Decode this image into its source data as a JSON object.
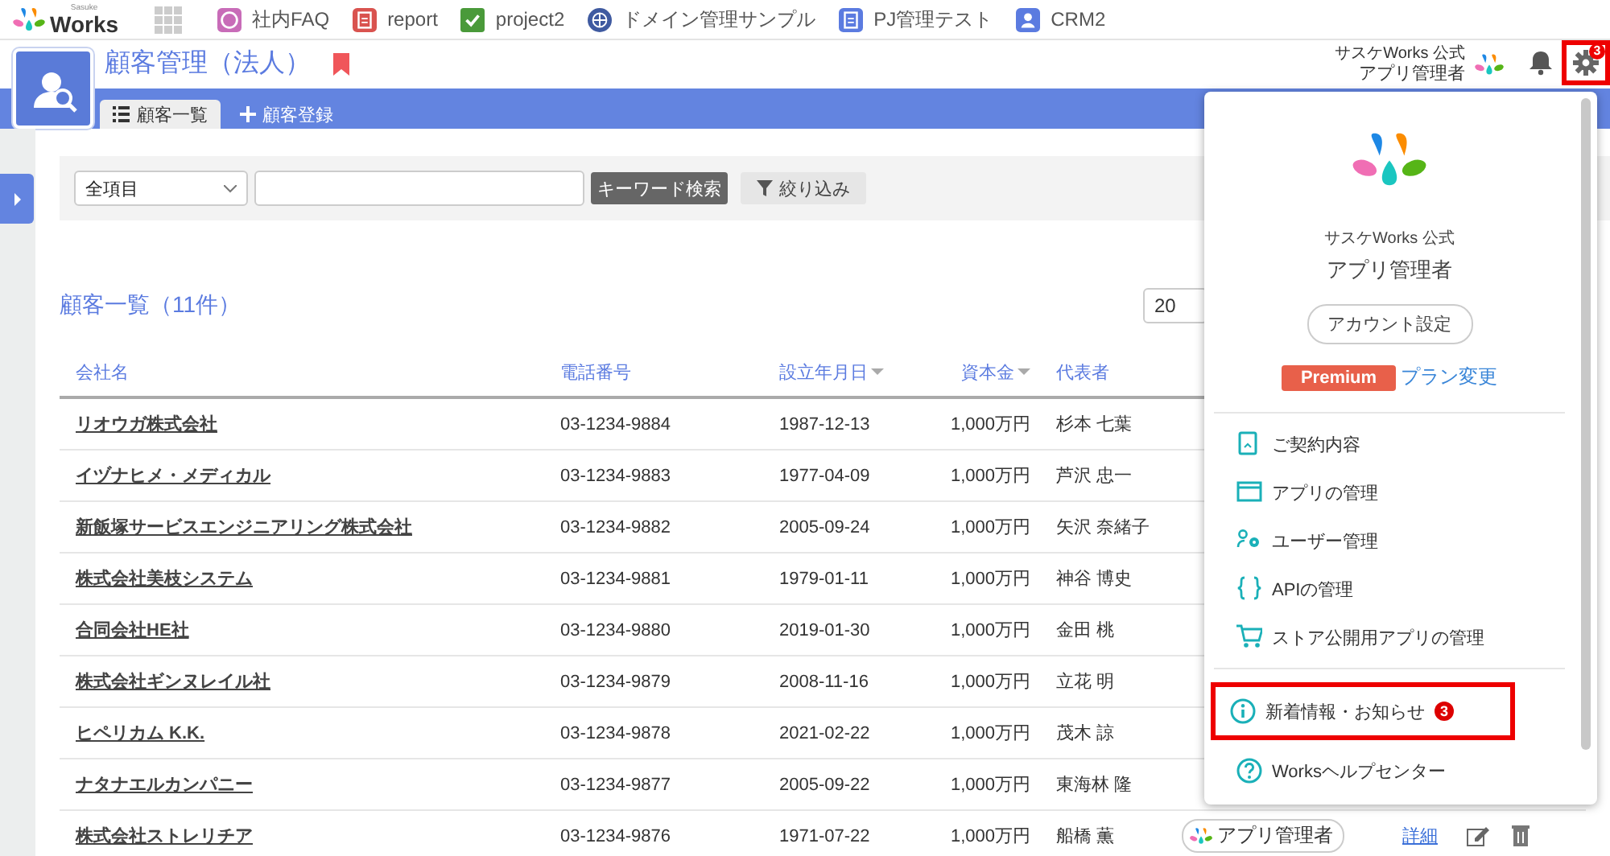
{
  "topbar": {
    "logo_small": "Sasuke",
    "logo": "Works",
    "apps": [
      {
        "label": "社内FAQ",
        "kind": "faq",
        "color": "#c86cb8"
      },
      {
        "label": "report",
        "kind": "doc",
        "color": "#d9534f"
      },
      {
        "label": "project2",
        "kind": "check",
        "color": "#4a9a3a"
      },
      {
        "label": "ドメイン管理サンプル",
        "kind": "globe",
        "color": "#3f5aa0"
      },
      {
        "label": "PJ管理テスト",
        "kind": "doc",
        "color": "#5b7be0"
      },
      {
        "label": "CRM2",
        "kind": "person",
        "color": "#5b7be0"
      }
    ]
  },
  "header": {
    "title": "顧客管理（法人）",
    "bookmarked": true,
    "tabs": [
      {
        "label": "顧客一覧",
        "kind": "list",
        "selected": true
      },
      {
        "label": "顧客登録",
        "kind": "add",
        "selected": false
      }
    ],
    "user": {
      "org": "サスケWorks 公式",
      "role": "アプリ管理者"
    },
    "settings_badge": "3",
    "settings_highlighted": true
  },
  "search": {
    "scope": "全項目",
    "search_button": "キーワード検索",
    "filter_button": "絞り込み"
  },
  "list": {
    "title": "顧客一覧（11件）",
    "page_size": "20",
    "columns": [
      {
        "label": "会社名",
        "sortable": false
      },
      {
        "label": "電話番号",
        "sortable": false
      },
      {
        "label": "設立年月日",
        "sortable": true
      },
      {
        "label": "資本金",
        "sortable": true
      },
      {
        "label": "代表者",
        "sortable": false
      }
    ],
    "rows": [
      {
        "company": "リオウガ株式会社",
        "phone": "03-1234-9884",
        "founded": "1987-12-13",
        "capital": "1,000万円",
        "ceo": "杉本 七葉"
      },
      {
        "company": "イヅナヒメ・メディカル",
        "phone": "03-1234-9883",
        "founded": "1977-04-09",
        "capital": "1,000万円",
        "ceo": "芦沢 忠一"
      },
      {
        "company": "新飯塚サービスエンジニアリング株式会社",
        "phone": "03-1234-9882",
        "founded": "2005-09-24",
        "capital": "1,000万円",
        "ceo": "矢沢 奈緒子"
      },
      {
        "company": "株式会社美枝システム",
        "phone": "03-1234-9881",
        "founded": "1979-01-11",
        "capital": "1,000万円",
        "ceo": "神谷 博史"
      },
      {
        "company": "合同会社HE社",
        "phone": "03-1234-9880",
        "founded": "2019-01-30",
        "capital": "1,000万円",
        "ceo": "金田 桃"
      },
      {
        "company": "株式会社ギンヌレイル社",
        "phone": "03-1234-9879",
        "founded": "2008-11-16",
        "capital": "1,000万円",
        "ceo": "立花 明"
      },
      {
        "company": "ヒペリカム K.K.",
        "phone": "03-1234-9878",
        "founded": "2021-02-22",
        "capital": "1,000万円",
        "ceo": "茂木 諒"
      },
      {
        "company": "ナタナエルカンパニー",
        "phone": "03-1234-9877",
        "founded": "2005-09-22",
        "capital": "1,000万円",
        "ceo": "東海林 隆"
      },
      {
        "company": "株式会社ストレリチア",
        "phone": "03-1234-9876",
        "founded": "1971-07-22",
        "capital": "1,000万円",
        "ceo": "船橋 薫",
        "owner": "アプリ管理者",
        "detail": "詳細"
      }
    ]
  },
  "menu": {
    "org": "サスケWorks 公式",
    "role": "アプリ管理者",
    "account_button": "アカウント設定",
    "plan": "Premium",
    "plan_link": "プラン変更",
    "sections": [
      [
        {
          "label": "ご契約内容",
          "kind": "contract",
          "highlighted": false
        },
        {
          "label": "アプリの管理",
          "kind": "window",
          "highlighted": false
        },
        {
          "label": "ユーザー管理",
          "kind": "users",
          "highlighted": false
        },
        {
          "label": "APIの管理",
          "kind": "braces",
          "highlighted": false
        },
        {
          "label": "ストア公開用アプリの管理",
          "kind": "cart",
          "highlighted": false
        }
      ],
      [
        {
          "label": "新着情報・お知らせ",
          "kind": "info",
          "badge": "3",
          "highlighted": true
        },
        {
          "label": "Worksヘルプセンター",
          "kind": "help",
          "highlighted": false
        }
      ]
    ]
  }
}
